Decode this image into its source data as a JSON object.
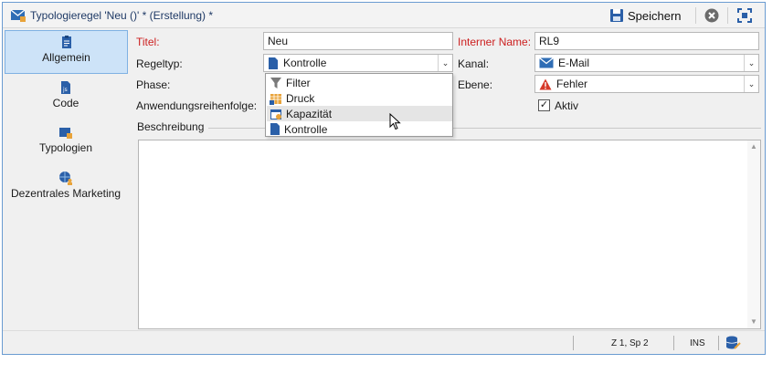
{
  "window": {
    "title": "Typologieregel 'Neu ()' * (Erstellung) *",
    "save_label": "Speichern"
  },
  "sidebar": {
    "items": [
      {
        "label": "Allgemein",
        "icon": "document-icon",
        "active": true
      },
      {
        "label": "Code",
        "icon": "code-file-icon",
        "active": false
      },
      {
        "label": "Typologien",
        "icon": "typology-folder-icon",
        "active": false
      },
      {
        "label": "Dezentrales Marketing",
        "icon": "globe-user-icon",
        "active": false
      }
    ]
  },
  "form": {
    "titel_label": "Titel:",
    "titel_value": "Neu",
    "interner_name_label": "Interner Name:",
    "interner_name_value": "RL9",
    "regeltyp_label": "Regeltyp:",
    "regeltyp_value": "Kontrolle",
    "kanal_label": "Kanal:",
    "kanal_value": "E-Mail",
    "phase_label": "Phase:",
    "ebene_label": "Ebene:",
    "ebene_value": "Fehler",
    "reihenfolge_label": "Anwendungsreihenfolge:",
    "aktiv_label": "Aktiv",
    "aktiv_checked": true,
    "beschreibung_label": "Beschreibung"
  },
  "dropdown": {
    "options": [
      {
        "label": "Filter",
        "icon": "filter-icon",
        "hover": false
      },
      {
        "label": "Druck",
        "icon": "print-icon",
        "hover": false
      },
      {
        "label": "Kapazität",
        "icon": "capacity-icon",
        "hover": true
      },
      {
        "label": "Kontrolle",
        "icon": "control-icon",
        "hover": false
      }
    ]
  },
  "statusbar": {
    "position": "Z 1, Sp 2",
    "mode": "INS"
  },
  "colors": {
    "accent": "#1f5fa8",
    "required": "#cc1f1f",
    "active_bg": "#cde3f8"
  }
}
